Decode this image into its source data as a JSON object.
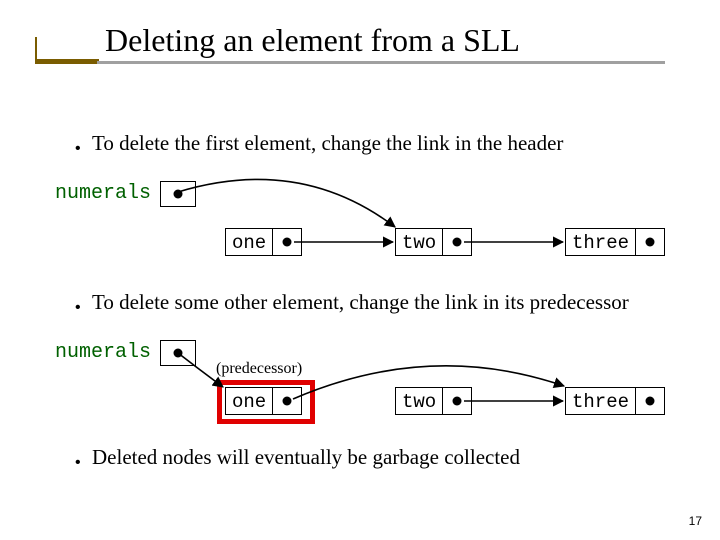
{
  "title": "Deleting an element from a SLL",
  "bullets": {
    "b1": "To delete the first element, change the link in the header",
    "b2": "To delete some other element, change the link in its predecessor",
    "b3": "Deleted nodes will eventually be garbage collected"
  },
  "labels": {
    "listName": "numerals",
    "pred": "(predecessor)",
    "bulletGlyph": "•"
  },
  "nodes": {
    "one": "one",
    "two": "two",
    "three": "three"
  },
  "pageNumber": "17"
}
